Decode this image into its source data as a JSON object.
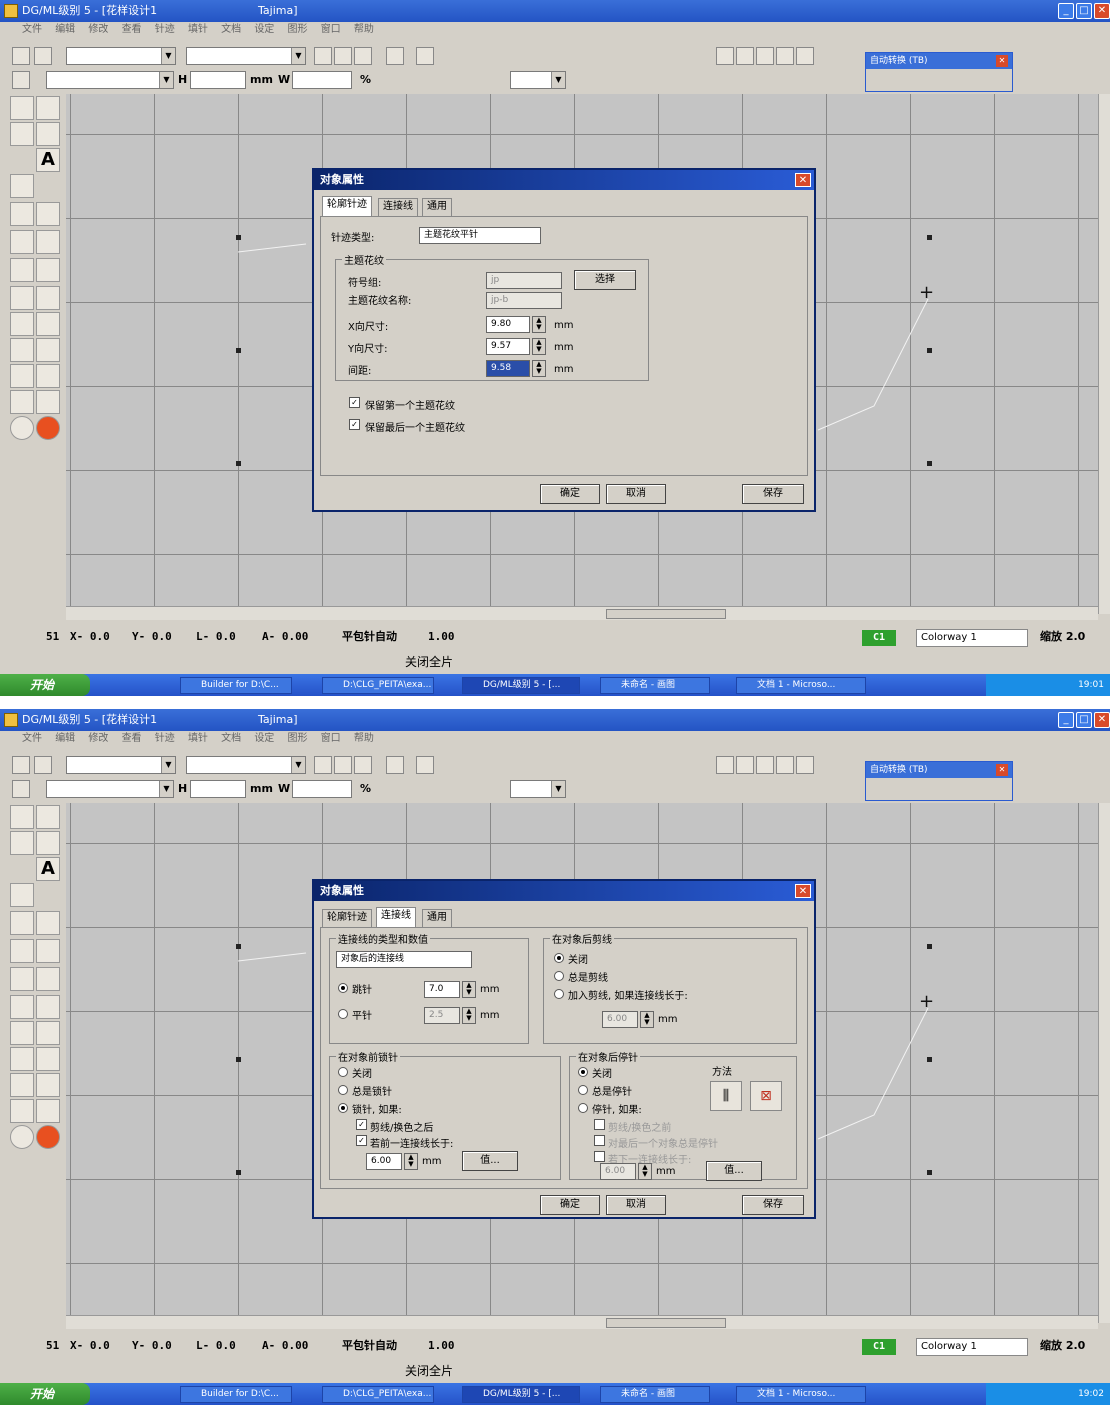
{
  "window": {
    "title": "DG/ML级别 5 - [花样设计1",
    "title_right": "Tajima]",
    "menu": [
      "文件",
      "编辑",
      "修改",
      "查看",
      "针迹",
      "填针",
      "文档",
      "设定",
      "图形",
      "窗口",
      "帮助"
    ]
  },
  "toolbar": {
    "h_label": "H",
    "unit_label": "mm",
    "w_label": "W",
    "pct_label": "%"
  },
  "auto_panel": {
    "title": "自动转换 (TB)",
    "close": "✕"
  },
  "status": {
    "count": "51",
    "x": "X- 0.0",
    "y": "Y- 0.0",
    "l": "L- 0.0",
    "a": "A- 0.00",
    "mode": "平包针自动",
    "scale": "1.00",
    "color_chip": "C1",
    "colorway": "Colorway 1",
    "zoom": "缩放 2.0",
    "message": "关闭全片"
  },
  "taskbar": {
    "start": "开始",
    "tasks": [
      "Builder for D:\\C...",
      "D:\\CLG_PEITA\\exa...",
      "DG/ML级别 5 - [...",
      "未命名 - 画图",
      "文档 1 - Microso..."
    ],
    "clock1": "19:01",
    "clock2": "19:02"
  },
  "dialog": {
    "title": "对象属性",
    "close": "✕",
    "tabs": [
      "轮廓针迹",
      "连接线",
      "通用"
    ],
    "ok": "确定",
    "cancel": "取消",
    "save": "保存"
  },
  "dialog1": {
    "stitch_type_label": "针迹类型:",
    "stitch_type_value": "主题花纹平针",
    "motif_group": "主题花纹",
    "symbol_label": "符号组:",
    "symbol_value": "jp",
    "motif_name_label": "主题花纹名称:",
    "motif_name_value": "jp-b",
    "select_button": "选择",
    "x_size_label": "X向尺寸:",
    "x_size_value": "9.80",
    "y_size_label": "Y向尺寸:",
    "y_size_value": "9.57",
    "spacing_label": "间距:",
    "spacing_value": "9.58",
    "unit": "mm",
    "keep_first": "保留第一个主题花纹",
    "keep_last": "保留最后一个主题花纹"
  },
  "dialog2": {
    "conn_group": "连接线的类型和数值",
    "conn_type": "对象后的连接线",
    "run_stitch": "跳针",
    "run_value": "7.0",
    "flat_stitch": "平针",
    "flat_value": "2.5",
    "unit": "mm",
    "trim_group": "在对象后剪线",
    "trim_off": "关闭",
    "trim_always": "总是剪线",
    "trim_if": "加入剪线, 如果连接线长于:",
    "trim_value": "6.00",
    "before_group": "在对象前锁针",
    "before_off": "关闭",
    "before_always": "总是锁针",
    "before_if": "锁针, 如果:",
    "before_after_trim": "剪线/换色之后",
    "before_if_longer": "若前一连接线长于:",
    "before_value": "6.00",
    "value_button": "值...",
    "after_group": "在对象后停针",
    "method_label": "方法",
    "after_off": "关闭",
    "after_always": "总是停针",
    "after_if": "停针, 如果:",
    "after_opt1": "剪线/换色之前",
    "after_opt2": "对最后一个对象总是停针",
    "after_opt3": "若下一连接线长于:",
    "after_value": "6.00",
    "after_value_button": "值..."
  }
}
